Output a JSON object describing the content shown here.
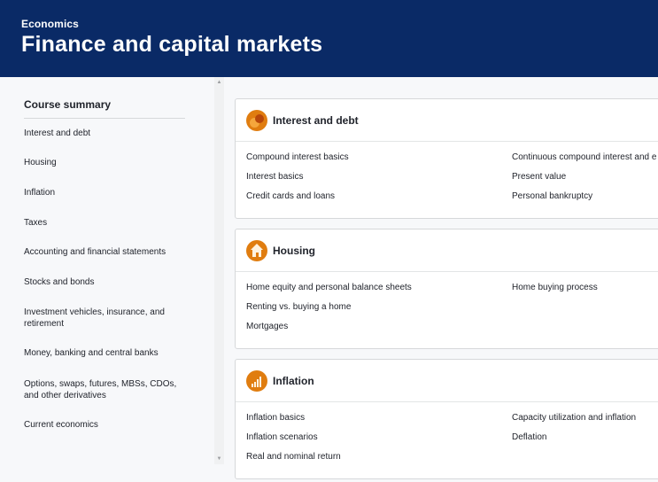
{
  "header": {
    "subject": "Economics",
    "title": "Finance and capital markets",
    "bg_color": "#0a2a66"
  },
  "sidebar": {
    "heading": "Course summary",
    "items": [
      {
        "label": "Interest and debt"
      },
      {
        "label": "Housing"
      },
      {
        "label": "Inflation"
      },
      {
        "label": "Taxes"
      },
      {
        "label": "Accounting and financial statements"
      },
      {
        "label": "Stocks and bonds"
      },
      {
        "label": "Investment vehicles, insurance, and retirement"
      },
      {
        "label": "Money, banking and central banks"
      },
      {
        "label": "Options, swaps, futures, MBSs, CDOs, and other derivatives"
      },
      {
        "label": "Current economics"
      }
    ]
  },
  "units": [
    {
      "title": "Interest and debt",
      "icon": "coins-icon",
      "links_left": [
        "Compound interest basics",
        "Interest basics",
        "Credit cards and loans"
      ],
      "links_right": [
        "Continuous compound interest and e",
        "Present value",
        "Personal bankruptcy"
      ]
    },
    {
      "title": "Housing",
      "icon": "house-icon",
      "links_left": [
        "Home equity and personal balance sheets",
        "Renting vs. buying a home",
        "Mortgages"
      ],
      "links_right": [
        "Home buying process"
      ]
    },
    {
      "title": "Inflation",
      "icon": "chart-icon",
      "links_left": [
        "Inflation basics",
        "Inflation scenarios",
        "Real and nominal return"
      ],
      "links_right": [
        "Capacity utilization and inflation",
        "Deflation"
      ]
    }
  ],
  "colors": {
    "accent": "#e07d10",
    "text": "#21242c",
    "border": "#d6d8da"
  }
}
